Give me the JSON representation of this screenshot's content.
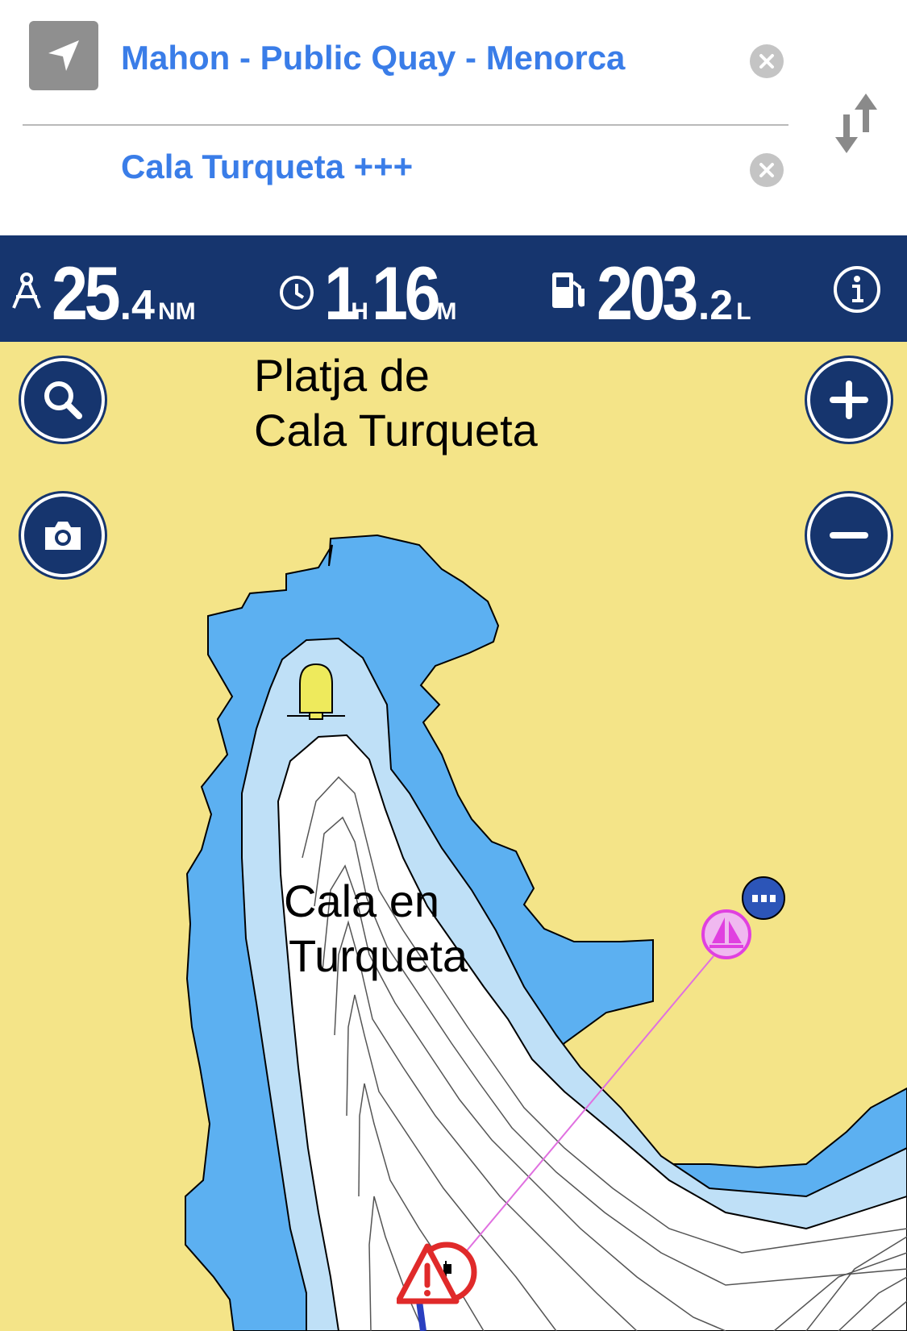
{
  "route": {
    "from": "Mahon - Public Quay - Menorca",
    "to": "Cala Turqueta +++"
  },
  "stats": {
    "distance": {
      "int": "25",
      "dec": ".4",
      "unit": "NM",
      "icon": "compass-icon"
    },
    "time": {
      "hours": "1",
      "hours_unit": "H",
      "minutes": "16",
      "minutes_unit": "M",
      "icon": "clock-icon"
    },
    "fuel": {
      "int": "203",
      "dec": ".2",
      "unit": "L",
      "icon": "fuel-pump-icon"
    }
  },
  "map": {
    "labels": {
      "beach_line1": "Platja de",
      "beach_line2": "Cala Turqueta",
      "cove_line1": "Cala en",
      "cove_line2": "Turqueta"
    }
  },
  "colors": {
    "header_text": "#3a7de8",
    "bar": "#16356e",
    "land": "#f4e488",
    "deep_water": "#5cb0f1",
    "shallow_water": "#bfe0f7",
    "sea": "#ffffff",
    "route_line": "#e070e0"
  },
  "icons": [
    "navigation-arrow-icon",
    "clear-icon",
    "swap-icon",
    "info-icon",
    "search-icon",
    "camera-icon",
    "plus-icon",
    "minus-icon",
    "bell-buoy-icon",
    "sailboat-icon",
    "more-icon",
    "hazard-warning-icon"
  ]
}
